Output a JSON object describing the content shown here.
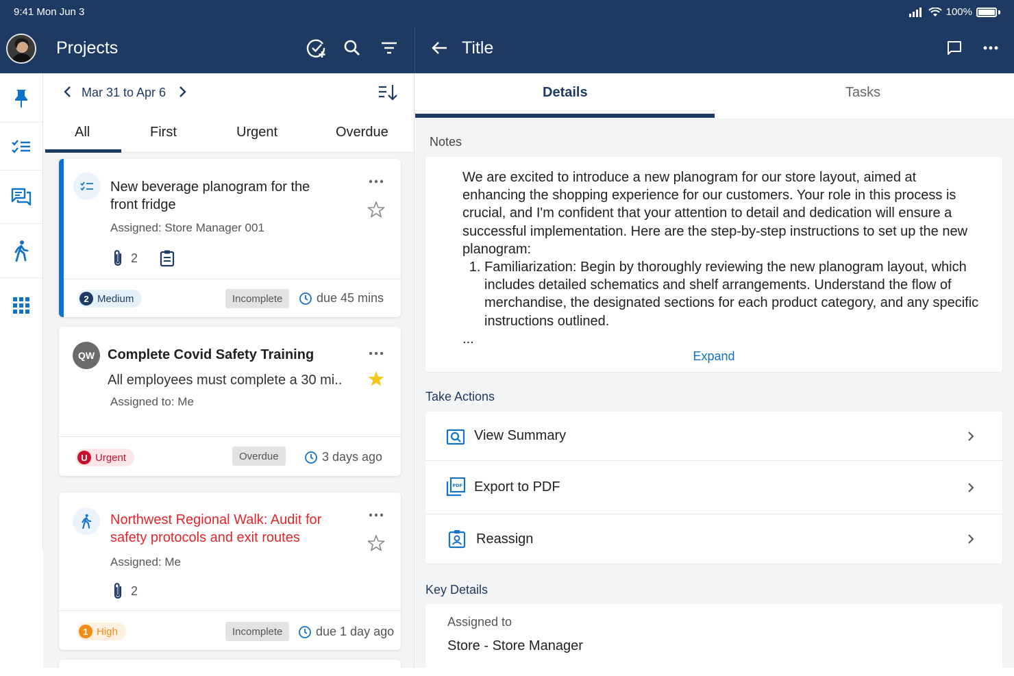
{
  "status_bar": {
    "time": "9:41 Mon Jun 3",
    "battery": "100%"
  },
  "header": {
    "title": "Projects",
    "detail_title": "Title"
  },
  "icons": {
    "avatar": "user-avatar",
    "header_actions": [
      "check-plus-icon",
      "search-icon",
      "filter-icon"
    ],
    "detail_actions": [
      "back-arrow-icon",
      "comment-icon",
      "more-icon"
    ],
    "rail": [
      "pin-icon",
      "checklist-icon",
      "chat-icon",
      "walk-icon",
      "grid-icon"
    ]
  },
  "date_range": {
    "label": "Mar 31 to Apr 6"
  },
  "filters": {
    "all": "All",
    "first": "First",
    "urgent": "Urgent",
    "overdue": "Overdue"
  },
  "tasks": [
    {
      "title": "New beverage planogram for the front fridge",
      "assigned": "Assigned: Store Manager 001",
      "attachments": "2",
      "priority_num": "2",
      "priority": "Medium",
      "status": "Incomplete",
      "due": "due 45 mins",
      "starred": false
    },
    {
      "initials": "QW",
      "title": "Complete Covid Safety Training",
      "description": "All employees must complete a 30 mi..",
      "assigned": "Assigned to: Me",
      "priority_num": "U",
      "priority": "Urgent",
      "status": "Overdue",
      "due": "3 days ago",
      "starred": true
    },
    {
      "title": "Northwest Regional Walk: Audit for safety protocols and exit routes",
      "assigned": "Assigned: Me",
      "attachments": "2",
      "priority_num": "1",
      "priority": "High",
      "status": "Incomplete",
      "due": "due 1 day ago",
      "starred": false
    }
  ],
  "detail": {
    "tabs": {
      "details": "Details",
      "tasks": "Tasks"
    },
    "notes_label": "Notes",
    "notes_intro": "We are excited to introduce a new planogram for our store layout, aimed at enhancing the shopping experience for our customers. Your role in this process is crucial, and I'm confident that your attention to detail and dedication will ensure a successful implementation. Here are the step-by-step instructions to set up the new planogram:",
    "notes_step1": "Familiarization: Begin by thoroughly reviewing the new planogram layout, which includes detailed schematics and shelf arrangements. Understand the flow of merchandise, the designated sections for each product category, and any specific instructions outlined.",
    "notes_ellipsis": "...",
    "expand": "Expand",
    "take_actions_label": "Take Actions",
    "actions": {
      "view_summary": "View Summary",
      "export_pdf": "Export to PDF",
      "reassign": "Reassign"
    },
    "key_details_label": "Key Details",
    "assigned_to_label": "Assigned to",
    "assigned_to_value": "Store - Store Manager"
  },
  "colors": {
    "header_bg": "#1d3a63",
    "accent": "#1172c9",
    "urgent": "#c8102e",
    "high": "#f28b18",
    "medium": "#1d3a63"
  }
}
